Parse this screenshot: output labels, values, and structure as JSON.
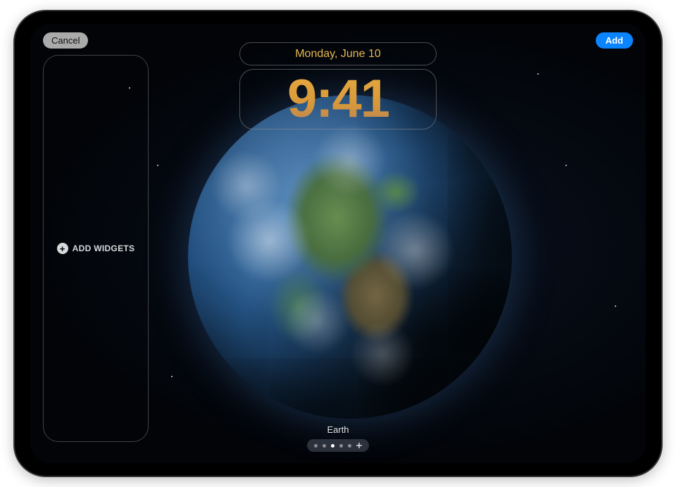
{
  "buttons": {
    "cancel": "Cancel",
    "add": "Add"
  },
  "lockscreen": {
    "date": "Monday, June 10",
    "time": "9:41",
    "wallpaper_name": "Earth"
  },
  "widgets": {
    "add_label": "ADD WIDGETS"
  },
  "pager": {
    "count": 5,
    "active_index": 2
  },
  "colors": {
    "accent": "#0a84ff",
    "clock": "#e6a93f"
  }
}
